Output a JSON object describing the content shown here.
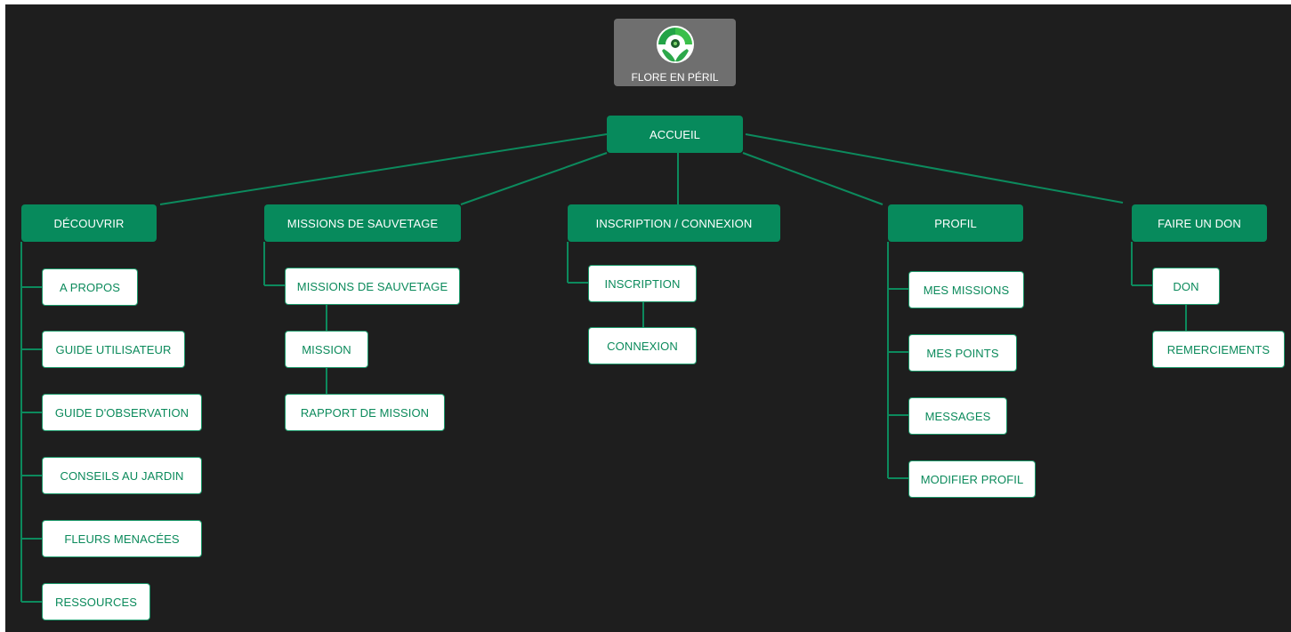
{
  "logo": {
    "name": "FLORE EN PÉRIL",
    "accent": "#3bbf4a"
  },
  "colors": {
    "node_fill": "#078a5c",
    "connector": "#0c8a5d",
    "background": "#1e1e1e",
    "leaf_text": "#0b8a5b"
  },
  "root": "ACCUEIL",
  "sections": [
    {
      "title": "DÉCOUVRIR",
      "pages": [
        "A PROPOS",
        "GUIDE UTILISATEUR",
        "GUIDE D'OBSERVATION",
        "CONSEILS AU JARDIN",
        "FLEURS MENACÉES",
        "RESSOURCES"
      ]
    },
    {
      "title": "MISSIONS DE SAUVETAGE",
      "pages": [
        "MISSIONS DE SAUVETAGE",
        "MISSION",
        "RAPPORT DE MISSION"
      ]
    },
    {
      "title": "INSCRIPTION / CONNEXION",
      "pages": [
        "INSCRIPTION",
        "CONNEXION"
      ]
    },
    {
      "title": "PROFIL",
      "pages": [
        "MES MISSIONS",
        "MES POINTS",
        "MESSAGES",
        "MODIFIER PROFIL"
      ]
    },
    {
      "title": "FAIRE UN DON",
      "pages": [
        "DON",
        "REMERCIEMENTS"
      ]
    }
  ]
}
